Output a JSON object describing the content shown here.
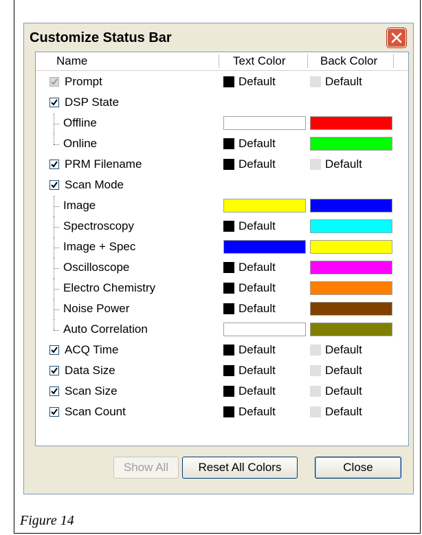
{
  "window": {
    "title": "Customize Status Bar"
  },
  "columns": {
    "name": "Name",
    "text_color": "Text Color",
    "back_color": "Back Color"
  },
  "rows": [
    {
      "name": "Prompt",
      "checkbox": true,
      "checked": true,
      "disabled": true,
      "text": "Default",
      "text_color": "#000000",
      "back": "Default",
      "back_color": "#e0e0e0"
    },
    {
      "name": "DSP State",
      "checkbox": true,
      "checked": true
    },
    {
      "name": "Offline",
      "child": true,
      "text_swatch": "#ffffff",
      "back_swatch": "#ff0000"
    },
    {
      "name": "Online",
      "child": true,
      "last": true,
      "text": "Default",
      "text_color": "#000000",
      "back_swatch": "#00ff00"
    },
    {
      "name": "PRM Filename",
      "checkbox": true,
      "checked": true,
      "text": "Default",
      "text_color": "#000000",
      "back": "Default",
      "back_color": "#e0e0e0"
    },
    {
      "name": "Scan Mode",
      "checkbox": true,
      "checked": true
    },
    {
      "name": "Image",
      "child": true,
      "text_swatch": "#ffff00",
      "back_swatch": "#0000ff"
    },
    {
      "name": "Spectroscopy",
      "child": true,
      "text": "Default",
      "text_color": "#000000",
      "back_swatch": "#00ffff"
    },
    {
      "name": "Image + Spec",
      "child": true,
      "text_swatch": "#0000ff",
      "back_swatch": "#ffff00"
    },
    {
      "name": "Oscilloscope",
      "child": true,
      "text": "Default",
      "text_color": "#000000",
      "back_swatch": "#ff00ff"
    },
    {
      "name": "Electro Chemistry",
      "child": true,
      "text": "Default",
      "text_color": "#000000",
      "back_swatch": "#ff8000"
    },
    {
      "name": "Noise Power",
      "child": true,
      "text": "Default",
      "text_color": "#000000",
      "back_swatch": "#804000"
    },
    {
      "name": "Auto Correlation",
      "child": true,
      "last": true,
      "text_swatch": "#ffffff",
      "back_swatch": "#808000"
    },
    {
      "name": "ACQ Time",
      "checkbox": true,
      "checked": true,
      "text": "Default",
      "text_color": "#000000",
      "back": "Default",
      "back_color": "#e0e0e0"
    },
    {
      "name": "Data Size",
      "checkbox": true,
      "checked": true,
      "text": "Default",
      "text_color": "#000000",
      "back": "Default",
      "back_color": "#e0e0e0"
    },
    {
      "name": "Scan Size",
      "checkbox": true,
      "checked": true,
      "text": "Default",
      "text_color": "#000000",
      "back": "Default",
      "back_color": "#e0e0e0"
    },
    {
      "name": "Scan Count",
      "checkbox": true,
      "checked": true,
      "text": "Default",
      "text_color": "#000000",
      "back": "Default",
      "back_color": "#e0e0e0"
    }
  ],
  "buttons": {
    "show_all": "Show All",
    "reset_all": "Reset All Colors",
    "close": "Close"
  },
  "caption": "Figure 14"
}
